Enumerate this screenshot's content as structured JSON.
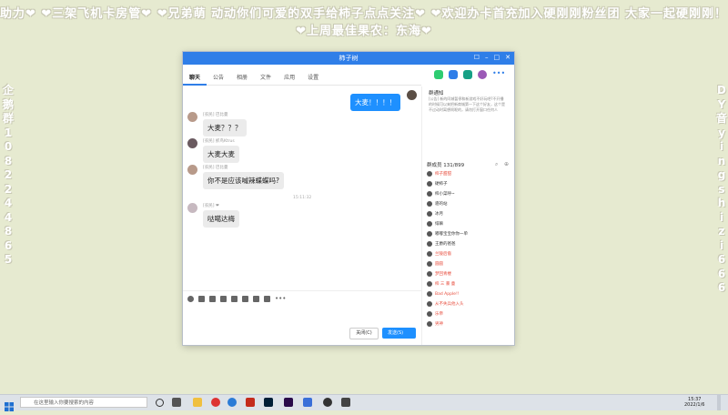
{
  "banner": {
    "line1": "助力❤ ❤三架飞机卡房管❤ ❤兄弟萌 动动你们可爱的双手给柿子点点关注❤ ❤欢迎办卡首充加入硬刚刚粉丝团 大家一起硬刚刚！ ❤",
    "line2": "❤上周最佳果农：东海❤"
  },
  "side_left": [
    "企",
    "鹅",
    "群",
    "1",
    "0",
    "8",
    "2",
    "2",
    "4",
    "4",
    "8",
    "6",
    "5"
  ],
  "side_right": [
    "D",
    "Y",
    "音",
    "y",
    "i",
    "n",
    "g",
    "s",
    "h",
    "i",
    "z",
    "i",
    "6",
    "6",
    "6"
  ],
  "window": {
    "title": "柿子树",
    "tabs": [
      "聊天",
      "公告",
      "相册",
      "文件",
      "应用",
      "设置"
    ],
    "messages": [
      {
        "meta": "[农民] 巴比曼",
        "text": "大麦？？？"
      },
      {
        "meta": "[农民] 抓鸟Ktrus",
        "text": "大麦大麦"
      },
      {
        "meta": "[农民] 巴比曼",
        "text": "你不是应该喊辣蝶蝶吗?"
      },
      {
        "meta": "[农民] ❤",
        "text": "哒噶达梅"
      }
    ],
    "my_message": "大麦！！！！",
    "timestamp1": "15:11:22",
    "timestamp2": "15:11:32",
    "close_btn": "关闭(C)",
    "send_btn": "发送(S)"
  },
  "group": {
    "notice_title": "群通知",
    "notice_body": "[公告] 新的同城暂停和新游戏不好玩吧?不开播的时候可以来把新商城第一下这个好友，这个是不过动时离想闹呢的，请勿打开窗口任何人",
    "members_title": "群成员 131/899",
    "members": [
      "柿子甜甜",
      "硬柿子",
      "柿小菜呼~",
      "骆的站",
      "冰月",
      "绯嘛",
      "嘟嘟宝宝你你一单",
      "王爵的爸爸",
      "兰陵后裔",
      "圆圆",
      "梦回青楼",
      "柿 三 暴 童",
      "Bad Apple!!",
      "从不失兵他入头",
      "乐帝",
      "男神"
    ]
  },
  "taskbar": {
    "search_placeholder": "在这里输入你要搜索的内容",
    "time": "15:37",
    "date": "2022/1/6"
  },
  "colors": {
    "accent": "#2f7ee8",
    "send": "#1e90ff",
    "background": "#e6ead0"
  }
}
